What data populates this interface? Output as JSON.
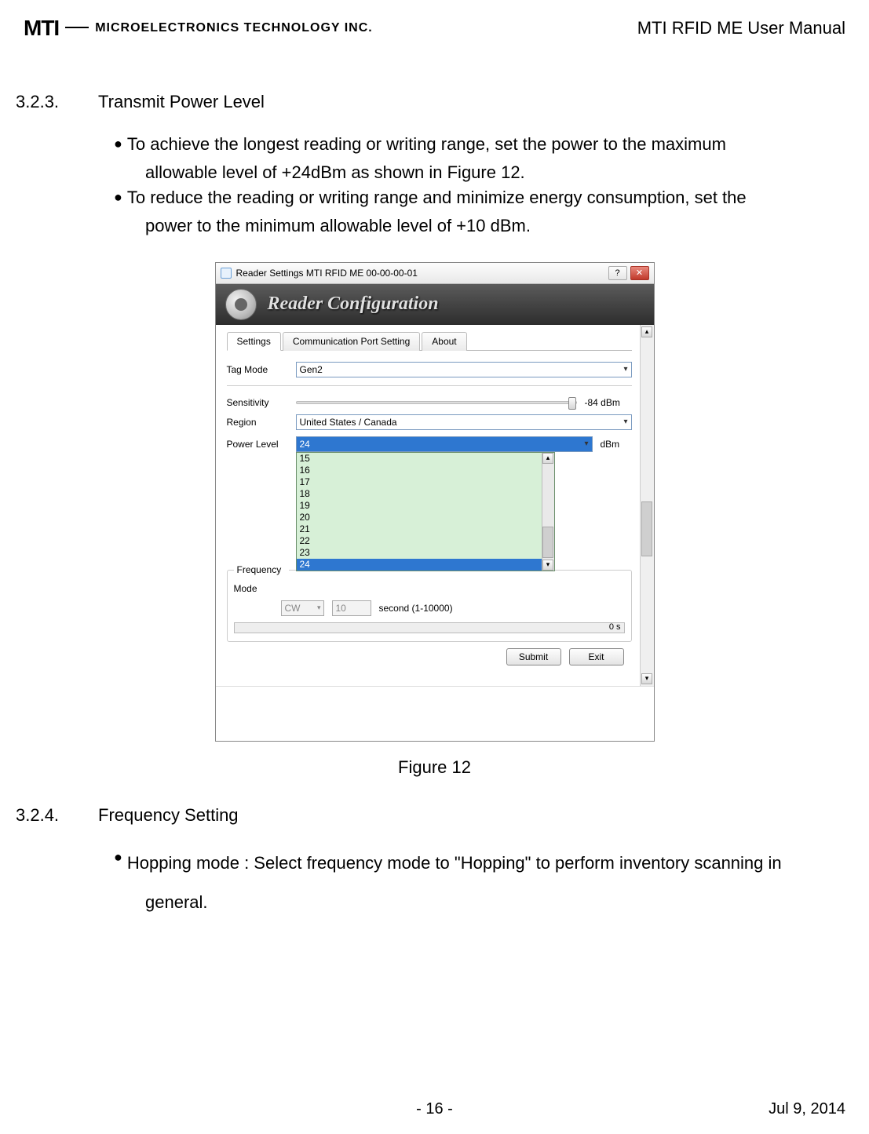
{
  "header": {
    "logo_text": "MTI",
    "company": "MICROELECTRONICS TECHNOLOGY INC.",
    "doc_title": "MTI RFID ME User Manual"
  },
  "section1": {
    "num": "3.2.3.",
    "title": "Transmit Power Level",
    "bullet1_a": "To achieve the longest reading or writing range, set the power to the maximum",
    "bullet1_b": "allowable level of +24dBm as shown in Figure 12.",
    "bullet2_a": "To reduce the reading or writing range and minimize energy consumption, set the",
    "bullet2_b": "power to the minimum allowable level of +10 dBm."
  },
  "dialog": {
    "title": "Reader Settings MTI RFID ME 00-00-00-01",
    "banner": "Reader Configuration",
    "tabs": {
      "settings": "Settings",
      "comm": "Communication Port Setting",
      "about": "About"
    },
    "form": {
      "tag_mode_label": "Tag Mode",
      "tag_mode_value": "Gen2",
      "sensitivity_label": "Sensitivity",
      "sensitivity_value": "-84 dBm",
      "region_label": "Region",
      "region_value": "United States / Canada",
      "power_label": "Power Level",
      "power_value": "24",
      "power_unit": "dBm",
      "power_options": [
        "15",
        "16",
        "17",
        "18",
        "19",
        "20",
        "21",
        "22",
        "23",
        "24"
      ],
      "freq_legend": "Frequency",
      "mode_label": "Mode",
      "cw_label": "CW",
      "spin_value": "10",
      "spin_suffix": "second (1-10000)",
      "progress_text": "0 s"
    },
    "buttons": {
      "submit": "Submit",
      "exit": "Exit"
    }
  },
  "figure_caption": "Figure 12",
  "section2": {
    "num": "3.2.4.",
    "title": "Frequency Setting",
    "bullet1_a": "Hopping mode : Select frequency mode to \"Hopping\" to perform inventory scanning in",
    "bullet1_b": "general."
  },
  "footer": {
    "page": "- 16 -",
    "date": "Jul 9, 2014"
  }
}
